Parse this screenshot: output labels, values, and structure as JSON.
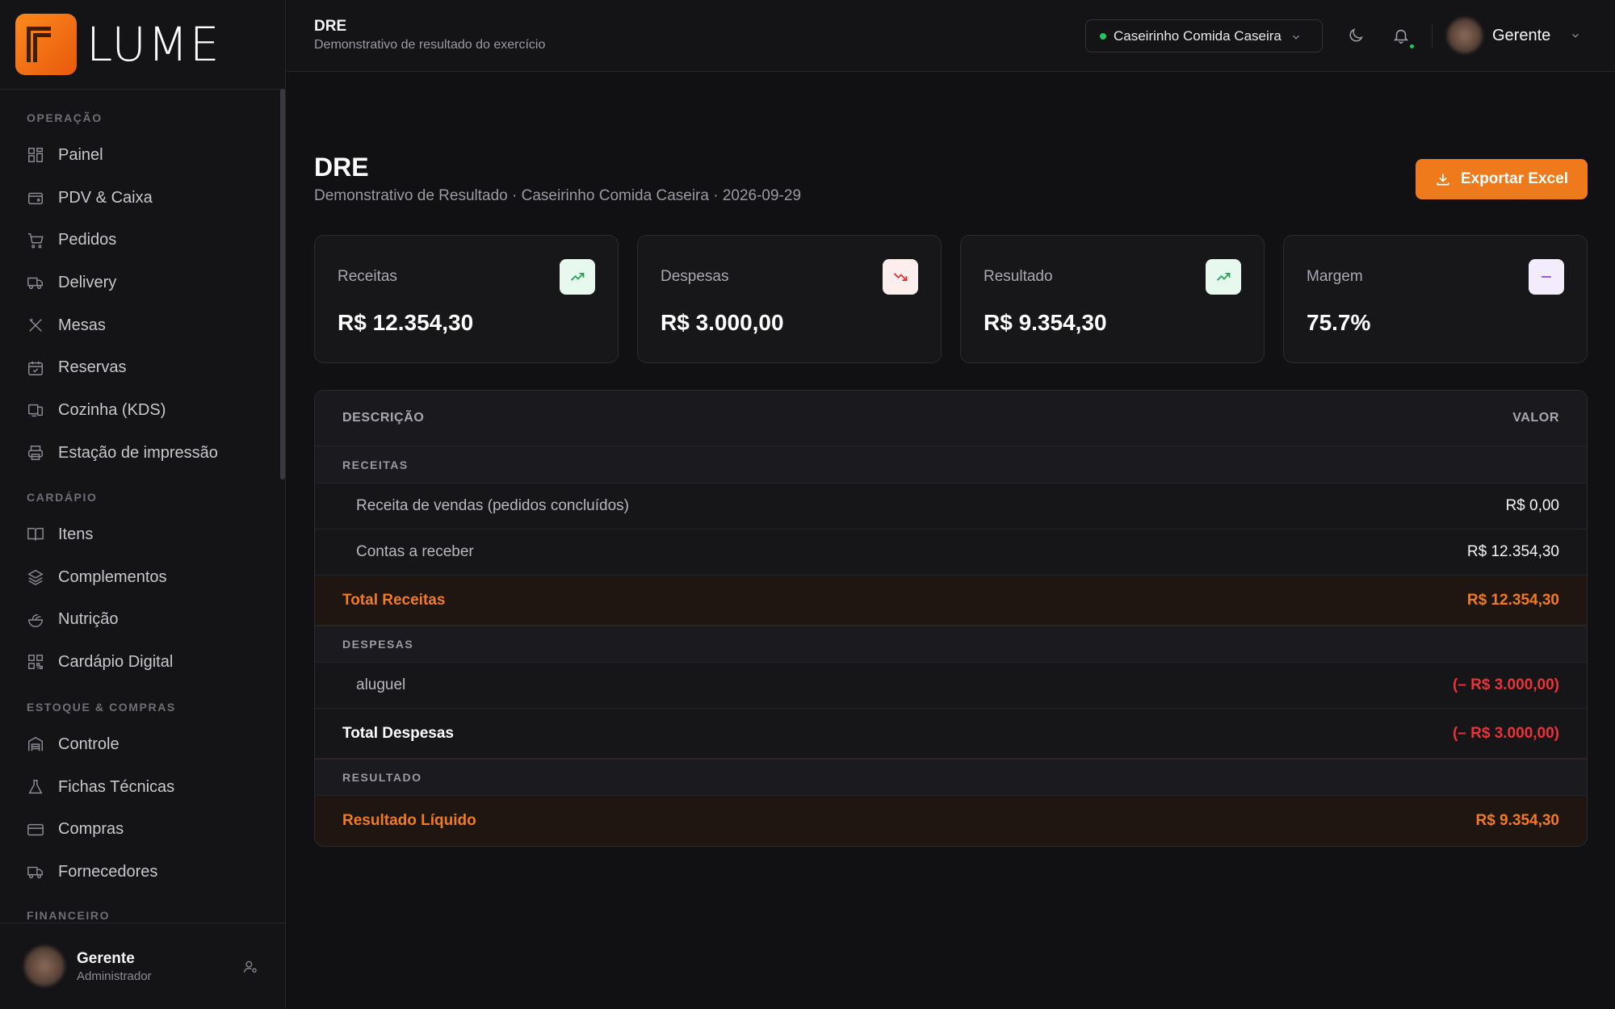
{
  "brand": {
    "name": "LUME"
  },
  "sidebar": {
    "sections": [
      {
        "title": "OPERAÇÃO",
        "items": [
          {
            "label": "Painel",
            "icon": "grid-icon"
          },
          {
            "label": "PDV & Caixa",
            "icon": "wallet-icon"
          },
          {
            "label": "Pedidos",
            "icon": "cart-icon"
          },
          {
            "label": "Delivery",
            "icon": "truck-icon"
          },
          {
            "label": "Mesas",
            "icon": "utensils-icon"
          },
          {
            "label": "Reservas",
            "icon": "calendar-check-icon"
          },
          {
            "label": "Cozinha (KDS)",
            "icon": "monitor-icon"
          },
          {
            "label": "Estação de impressão",
            "icon": "printer-icon"
          }
        ]
      },
      {
        "title": "CARDÁPIO",
        "items": [
          {
            "label": "Itens",
            "icon": "book-icon"
          },
          {
            "label": "Complementos",
            "icon": "layers-icon"
          },
          {
            "label": "Nutrição",
            "icon": "salad-icon"
          },
          {
            "label": "Cardápio Digital",
            "icon": "qr-code-icon"
          }
        ]
      },
      {
        "title": "ESTOQUE & COMPRAS",
        "items": [
          {
            "label": "Controle",
            "icon": "warehouse-icon"
          },
          {
            "label": "Fichas Técnicas",
            "icon": "flask-icon"
          },
          {
            "label": "Compras",
            "icon": "credit-card-icon"
          },
          {
            "label": "Fornecedores",
            "icon": "truck-icon"
          }
        ]
      },
      {
        "title": "FINANCEIRO",
        "items": []
      }
    ],
    "footer": {
      "name": "Gerente",
      "role": "Administrador"
    }
  },
  "topbar": {
    "title": "DRE",
    "subtitle": "Demonstrativo de resultado do exercício",
    "store": "Caseirinho Comida Caseira",
    "user": "Gerente"
  },
  "page": {
    "title": "DRE",
    "subtitle": "Demonstrativo de Resultado · Caseirinho Comida Caseira · 2026-09-29",
    "export_label": "Exportar Excel"
  },
  "cards": [
    {
      "label": "Receitas",
      "value": "R$ 12.354,30",
      "icon": "trending-up-icon",
      "tone": "green"
    },
    {
      "label": "Despesas",
      "value": "R$ 3.000,00",
      "icon": "trending-down-icon",
      "tone": "red"
    },
    {
      "label": "Resultado",
      "value": "R$ 9.354,30",
      "icon": "trending-up-icon",
      "tone": "green"
    },
    {
      "label": "Margem",
      "value": "75.7%",
      "icon": "minus-icon",
      "tone": "purple"
    }
  ],
  "table": {
    "headers": {
      "description": "DESCRIÇÃO",
      "value": "VALOR"
    },
    "rows": [
      {
        "kind": "section",
        "label": "RECEITAS",
        "value": ""
      },
      {
        "kind": "item",
        "label": "Receita de vendas (pedidos concluídos)",
        "value": "R$ 0,00"
      },
      {
        "kind": "item",
        "label": "Contas a receber",
        "value": "R$ 12.354,30"
      },
      {
        "kind": "total-orange",
        "label": "Total Receitas",
        "value": "R$ 12.354,30"
      },
      {
        "kind": "section",
        "label": "DESPESAS",
        "value": ""
      },
      {
        "kind": "item-neg",
        "label": "aluguel",
        "value": "(– R$ 3.000,00)"
      },
      {
        "kind": "total-white",
        "label": "Total Despesas",
        "value": "(– R$ 3.000,00)"
      },
      {
        "kind": "section",
        "label": "RESULTADO",
        "value": ""
      },
      {
        "kind": "total-orange",
        "label": "Resultado Líquido",
        "value": "R$ 9.354,30"
      }
    ]
  },
  "colors": {
    "accent": "#ef7a1c",
    "negative": "#e8333a",
    "positive": "#16a34a",
    "background": "#111114"
  }
}
